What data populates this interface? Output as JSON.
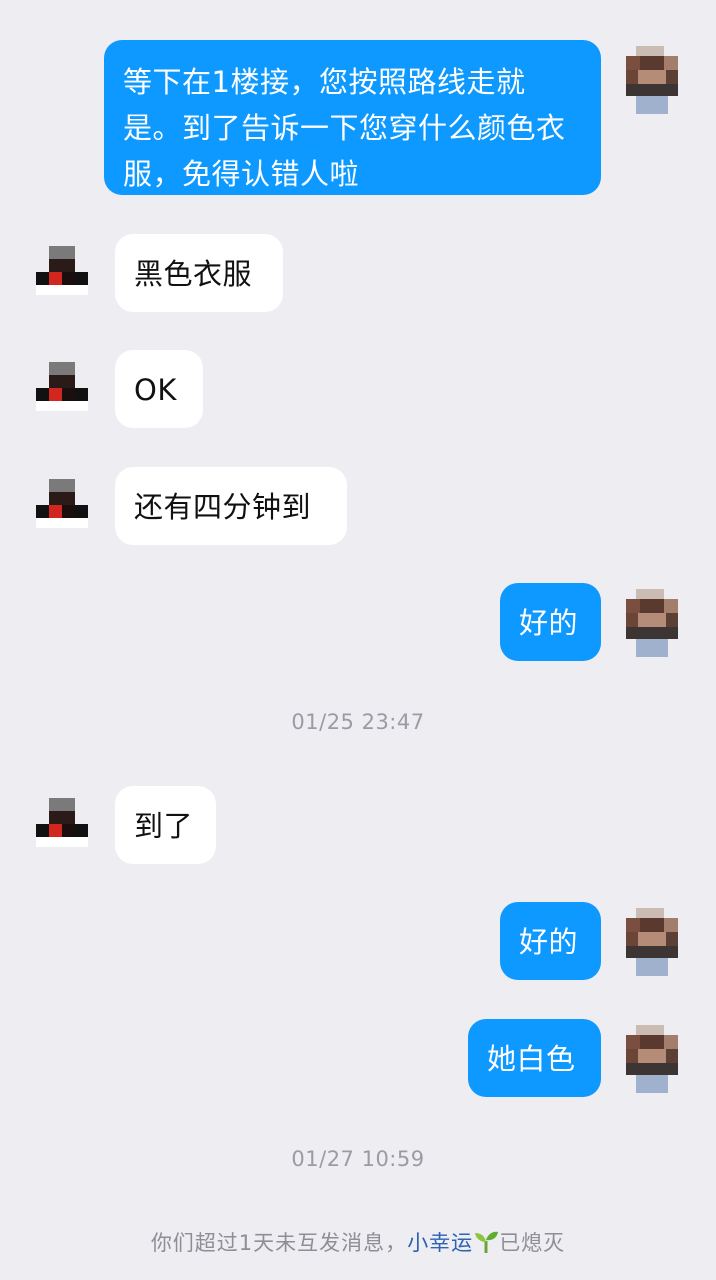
{
  "messages": [
    {
      "dir": "out",
      "text": "等下在1楼接，您按照路线走就是。到了告诉一下您穿什么颜色衣服，免得认错人啦"
    },
    {
      "dir": "in",
      "text": "黑色衣服"
    },
    {
      "dir": "in",
      "text": "OK"
    },
    {
      "dir": "in",
      "text": "还有四分钟到"
    },
    {
      "dir": "out",
      "text": "好的"
    },
    {
      "time": "01/25 23:47"
    },
    {
      "dir": "in",
      "text": "到了"
    },
    {
      "dir": "out",
      "text": "好的"
    },
    {
      "dir": "out",
      "text": "她白色"
    },
    {
      "time": "01/27 10:59"
    }
  ],
  "notice": {
    "prefix": "你们超过1天未互发消息，",
    "link": "小幸运",
    "icon": "sprout-icon",
    "suffix": "已熄灭"
  },
  "colors": {
    "background": "#ededf2",
    "outgoing_bubble": "#0d99ff",
    "incoming_bubble": "#ffffff",
    "link": "#2f62b5"
  }
}
